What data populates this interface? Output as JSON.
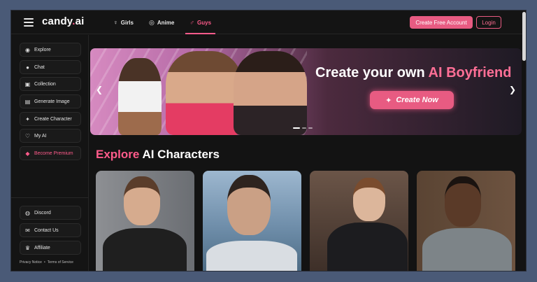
{
  "header": {
    "logo": {
      "text": "candy",
      "dot": ".",
      "suffix": "ai"
    },
    "nav": [
      {
        "label": "Girls",
        "icon": "female-icon"
      },
      {
        "label": "Anime",
        "icon": "anime-icon"
      },
      {
        "label": "Guys",
        "icon": "male-icon",
        "active": true
      }
    ],
    "create_account_label": "Create Free Account",
    "login_label": "Login"
  },
  "sidebar": {
    "items": [
      {
        "label": "Explore",
        "icon": "compass-icon"
      },
      {
        "label": "Chat",
        "icon": "chat-icon"
      },
      {
        "label": "Collection",
        "icon": "collection-icon"
      },
      {
        "label": "Generate Image",
        "icon": "image-icon"
      },
      {
        "label": "Create Character",
        "icon": "magic-wand-icon"
      },
      {
        "label": "My AI",
        "icon": "heart-icon"
      },
      {
        "label": "Become Premium",
        "icon": "diamond-icon"
      }
    ],
    "bottom_items": [
      {
        "label": "Discord",
        "icon": "discord-icon"
      },
      {
        "label": "Contact Us",
        "icon": "contact-icon"
      },
      {
        "label": "Affiliate",
        "icon": "trophy-icon"
      }
    ],
    "footer": {
      "privacy": "Privacy Notice",
      "sep": "•",
      "terms": "Terms of Service"
    }
  },
  "banner": {
    "title_pre": "Create your own ",
    "title_highlight": "AI Boyfriend",
    "cta_label": "Create Now",
    "slide_count": 3,
    "active_slide": 1
  },
  "section": {
    "title_highlight": "Explore",
    "title_rest": " AI Characters"
  },
  "colors": {
    "accent": "#e85b82",
    "background": "#131313",
    "outer": "#4a5a77"
  }
}
